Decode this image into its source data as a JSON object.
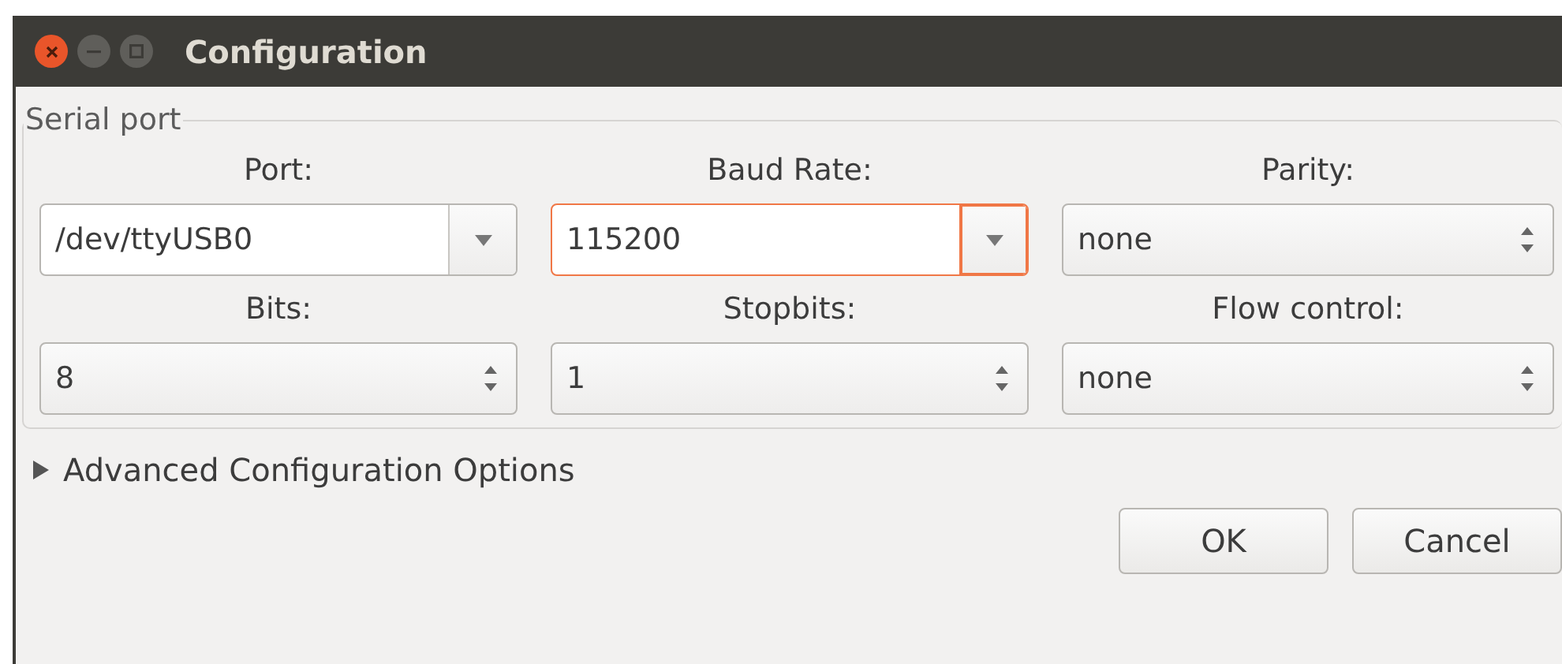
{
  "window": {
    "title": "Configuration"
  },
  "group": {
    "title": "Serial port"
  },
  "fields": [
    {
      "label": "Port:",
      "kind": "combo",
      "value": "/dev/ttyUSB0",
      "focused": false
    },
    {
      "label": "Baud Rate:",
      "kind": "combo",
      "value": "115200",
      "focused": true
    },
    {
      "label": "Parity:",
      "kind": "spin",
      "value": "none",
      "focused": false
    },
    {
      "label": "Bits:",
      "kind": "spin",
      "value": "8",
      "focused": false
    },
    {
      "label": "Stopbits:",
      "kind": "spin",
      "value": "1",
      "focused": false
    },
    {
      "label": "Flow control:",
      "kind": "spin",
      "value": "none",
      "focused": false
    }
  ],
  "expander": {
    "label": "Advanced Configuration Options",
    "expanded": false
  },
  "buttons": [
    "OK",
    "Cancel"
  ]
}
